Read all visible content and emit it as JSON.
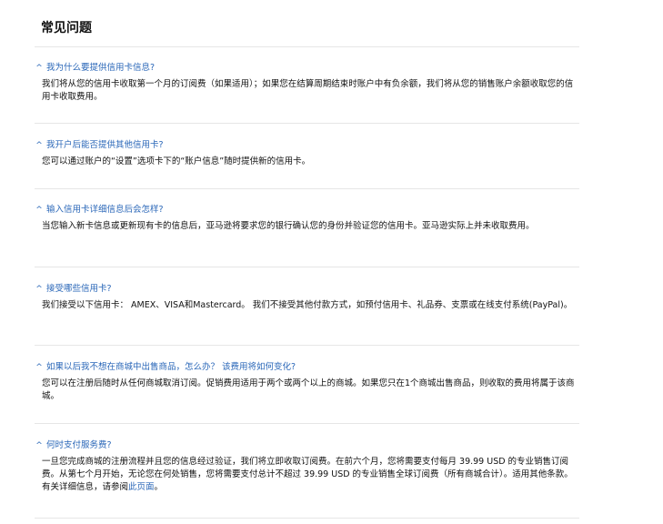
{
  "page_title": "常见问题",
  "faqs": [
    {
      "question": "我为什么要提供信用卡信息?",
      "answer": "我们将从您的信用卡收取第一个月的订阅费（如果适用）；如果您在结算周期结束时账户中有负余额，我们将从您的销售账户余额收取您的信用卡收取费用。"
    },
    {
      "question": "我开户后能否提供其他信用卡?",
      "answer": "您可以通过账户的“设置”选项卡下的“账户信息”随时提供新的信用卡。"
    },
    {
      "question": "输入信用卡详细信息后会怎样?",
      "answer": "当您输入新卡信息或更新现有卡的信息后，亚马逊将要求您的银行确认您的身份并验证您的信用卡。亚马逊实际上并未收取费用。"
    },
    {
      "question": "接受哪些信用卡?",
      "answer": "我们接受以下信用卡： AMEX、VISA和Mastercard。 我们不接受其他付款方式，如预付信用卡、礼品券、支票或在线支付系统(PayPal)。"
    },
    {
      "question": "如果以后我不想在商城中出售商品，怎么办？ 该费用将如何变化?",
      "answer": "您可以在注册后随时从任何商城取消订阅。促销费用适用于两个或两个以上的商城。如果您只在1个商城出售商品，则收取的费用将属于该商城。"
    },
    {
      "question": "何时支付服务费?",
      "answer": "一旦您完成商城的注册流程并且您的信息经过验证，我们将立即收取订阅费。在前六个月，您将需要支付每月 39.99 USD 的专业销售订阅费。从第七个月开始，无论您在何处销售，您将需要支付总计不超过 39.99 USD 的专业销售全球订阅费（所有商城合计）。适用其他条款。有关详细信息，请参阅",
      "link_text": "此页面",
      "answer_end": "。"
    }
  ],
  "colors": {
    "question": "#2a67b8",
    "text": "#111111",
    "divider": "#e6e6e6"
  },
  "icons": {
    "collapse": "caret-up-icon"
  }
}
